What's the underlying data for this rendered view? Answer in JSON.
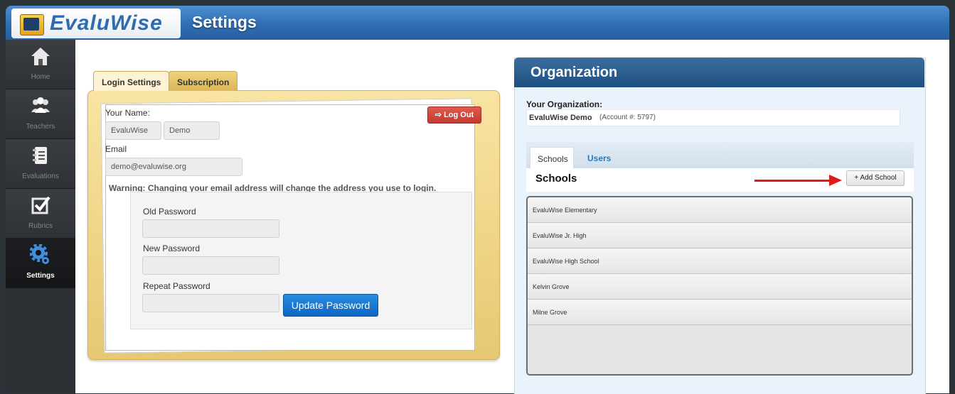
{
  "header": {
    "logo_text": "EvaluWise",
    "title": "Settings"
  },
  "sidebar": {
    "items": [
      {
        "label": "Home",
        "icon": "home-icon"
      },
      {
        "label": "Teachers",
        "icon": "teachers-icon"
      },
      {
        "label": "Evaluations",
        "icon": "evaluations-icon"
      },
      {
        "label": "Rubrics",
        "icon": "rubrics-icon"
      },
      {
        "label": "Settings",
        "icon": "gear-icon",
        "active": true
      }
    ]
  },
  "login": {
    "tabs": [
      {
        "label": "Login Settings",
        "active": true
      },
      {
        "label": "Subscription"
      }
    ],
    "name_label": "Your Name:",
    "first_name": "EvaluWise",
    "last_name": "Demo",
    "logout_label": "Log Out",
    "email_label": "Email",
    "email_value": "demo@evaluwise.org",
    "warning": "Warning: Changing your email address will change the address you use to login.",
    "old_password_label": "Old Password",
    "new_password_label": "New Password",
    "repeat_password_label": "Repeat Password",
    "update_label": "Update Password"
  },
  "organization": {
    "title": "Organization",
    "your_org_label": "Your Organization:",
    "org_name": "EvaluWise Demo",
    "account": "(Account #: 5797)",
    "tabs": [
      {
        "label": "Schools",
        "active": true
      },
      {
        "label": "Users"
      }
    ],
    "schools_heading": "Schools",
    "add_school_label": "+ Add School",
    "schools": [
      "EvaluWise Elementary",
      "EvaluWise Jr. High",
      "EvaluWise High School",
      "Kelvin Grove",
      "Milne Grove"
    ]
  },
  "colors": {
    "header_blue": "#2f6eb3",
    "logout_red": "#c33a2f",
    "update_blue": "#0a66c2",
    "annotation_arrow": "#e01b1b"
  }
}
